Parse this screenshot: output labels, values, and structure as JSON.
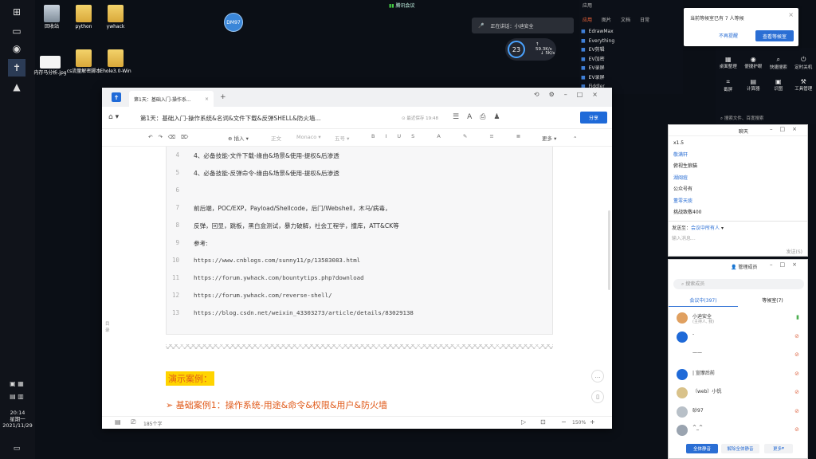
{
  "desktop": {
    "icons": [
      {
        "label": "回收站"
      },
      {
        "label": "python"
      },
      {
        "label": "ywhack"
      },
      {
        "label": "内存马分析.jpg"
      },
      {
        "label": "cs流量解密脚本"
      },
      {
        "label": "Ehole3.0-Win"
      }
    ]
  },
  "meeting_bar": {
    "label": "腾讯会议"
  },
  "avatar_bubble": {
    "label": "DM97"
  },
  "speaking": {
    "label": "正在讲话：小迪安全"
  },
  "net": {
    "percent": "23",
    "up": "59.3K/s",
    "down": "5K/s"
  },
  "launcher": {
    "header": "应用",
    "tabs": [
      "应用",
      "图片",
      "文档",
      "日常"
    ],
    "items": [
      "EdrawMax",
      "Everything",
      "EV剪辑",
      "EV加密",
      "EV录屏",
      "EV录屏",
      "Fiddler"
    ]
  },
  "rightpanel": {
    "row1": [
      "桌面整理",
      "便捷护眼",
      "快捷搜索",
      "定时关机"
    ],
    "row2": [
      "截屏",
      "计算器",
      "识图",
      "工具管理"
    ],
    "search": "搜索文件、百度搜索"
  },
  "notify": {
    "message": "当前等候室已有 7 人等候",
    "btn_ignore": "不再提醒",
    "btn_view": "查看等候室"
  },
  "chat": {
    "title": "聊天",
    "messages": [
      {
        "text": "x1.5",
        "blue": false
      },
      {
        "text": "敬满轩",
        "blue": true
      },
      {
        "text": "俯视生狼猫",
        "blue": false
      },
      {
        "text": "湖闽痘",
        "blue": true
      },
      {
        "text": "公众号有",
        "blue": false
      },
      {
        "text": "董零天痰",
        "blue": true
      },
      {
        "text": "挑战致敬400",
        "blue": false
      }
    ],
    "send_to_label": "发送至：",
    "send_to_value": "会议中所有人",
    "placeholder": "输入消息...",
    "send_button": "发送(S)"
  },
  "members": {
    "title": "管理成员",
    "search_placeholder": "搜索成员",
    "tab_in_meeting": "会议中(397)",
    "tab_waiting": "等候室(7)",
    "rows": [
      {
        "name": "小迪安全",
        "sub": "(主持人, 我)",
        "avatar": "#e0a060"
      },
      {
        "name": "-",
        "sub": "",
        "avatar": "#1f6ad8"
      },
      {
        "name": "——",
        "sub": "",
        "avatar": "#ffffff"
      },
      {
        "name": "| 宣摩后前",
        "sub": "",
        "avatar": "#1f6ad8"
      },
      {
        "name": "（web）小钒",
        "sub": "",
        "avatar": "#d9c28a"
      },
      {
        "name": "砂97",
        "sub": "",
        "avatar": "#b8c0c8"
      },
      {
        "name": "^_^",
        "sub": "",
        "avatar": "#9aa4b0"
      }
    ],
    "btn_mute_all": "全体静音",
    "btn_unmute_all": "解除全体静音",
    "btn_more": "更多"
  },
  "doc": {
    "tab_title": "第1天：基础入门-操作系...",
    "title": "第1天：基础入门-操作系统&名词&文件下载&反弹SHELL&防火墙...",
    "saved": "最近保存 19:48",
    "share": "分享",
    "toolbar": {
      "insert": "插入",
      "body": "正文",
      "font": "Monaco",
      "size": "五号",
      "more": "更多"
    },
    "lines": [
      {
        "n": "4",
        "text": "4、必备技能-文件下载-缘由&场景&使用-提权&后渗透",
        "mono": false
      },
      {
        "n": "5",
        "text": "4、必备技能-反弹命令-缘由&场景&使用-提权&后渗透",
        "mono": false
      },
      {
        "n": "6",
        "text": "",
        "mono": false
      },
      {
        "n": "7",
        "text": "前后端，POC/EXP，Payload/Shellcode，后门/Webshell，木马/病毒，",
        "mono": false
      },
      {
        "n": "8",
        "text": "反弹，回显，跳板，黑白盒测试，暴力破解，社会工程学，撞库，ATT&CK等",
        "mono": false
      },
      {
        "n": "9",
        "text": "参考:",
        "mono": false
      },
      {
        "n": "10",
        "text": "https://www.cnblogs.com/sunny11/p/13583083.html",
        "mono": true
      },
      {
        "n": "11",
        "text": "https://forum.ywhack.com/bountytips.php?download",
        "mono": true
      },
      {
        "n": "12",
        "text": "https://forum.ywhack.com/reverse-shell/",
        "mono": true
      },
      {
        "n": "13",
        "text": "https://blog.csdn.net/weixin_43303273/article/details/83029138",
        "mono": true
      }
    ],
    "demo_heading": "演示案例：",
    "case_line": "➢  基础案例1：操作系统-用途&命令&权限&用户&防火墙",
    "outline_label": "目录",
    "word_count": "185个字",
    "zoom": "150%"
  },
  "tray": {
    "time": "20:14",
    "weekday": "星期一",
    "date": "2021/11/29"
  }
}
